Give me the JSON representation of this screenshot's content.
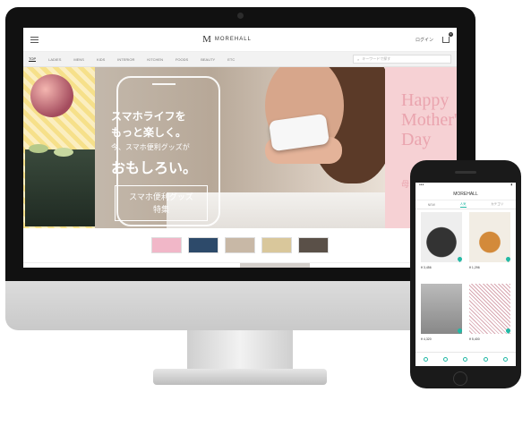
{
  "desktop": {
    "logo_text": "MOREHALL",
    "login_label": "ログイン",
    "cart_count": "0",
    "nav_items": [
      "TOP",
      "LADIES",
      "MENS",
      "KIDS",
      "INTERIOR",
      "KITCHEN",
      "FOODS",
      "BEAUTY",
      "ETC"
    ],
    "search_placeholder": "キーワードで探す",
    "hero": {
      "line1": "スマホライフを",
      "line2": "もっと楽しく。",
      "line3": "今、スマホ便利グッズが",
      "line4": "おもしろい。",
      "cta_line1": "スマホ便利グッズ",
      "cta_line2": "特集",
      "side_text": "Happy Mother's Day",
      "side_small": "母"
    }
  },
  "mobile": {
    "title": "MOREHALL",
    "tabs": [
      "NEW",
      "人気",
      "カテゴリ"
    ],
    "items": [
      {
        "price": "¥ 3,456"
      },
      {
        "price": "¥ 1,296"
      },
      {
        "price": "¥ 4,320"
      },
      {
        "price": "¥ 5,400"
      }
    ]
  },
  "colors": {
    "accent": "#25b9a5",
    "hero_pink": "#f6d1d4",
    "stripe": "#f6e08a"
  }
}
